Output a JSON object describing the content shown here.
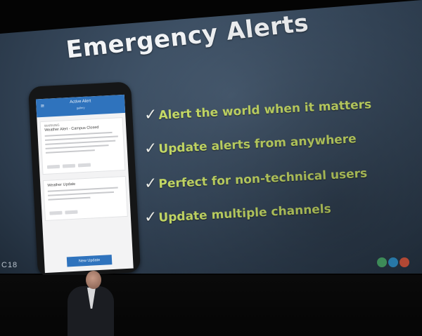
{
  "slide": {
    "title": "Emergency Alerts",
    "bullets": [
      "Alert the world when it matters",
      "Update alerts from anywhere",
      "Perfect for non-technical users",
      "Update multiple channels"
    ],
    "check_glyph": "✓",
    "code": "C18",
    "logo_colors": [
      "#4aa86a",
      "#2f8fc7",
      "#d2553e"
    ]
  },
  "phone": {
    "app_title": "Active Alert",
    "app_subtitle": "gallery",
    "menu_icon": "≡",
    "card1_label": "WARNING",
    "card1_title": "Weather Alert - Campus Closed",
    "card2_title": "Weather Update",
    "update_button": "New Update"
  },
  "colors": {
    "bullet_text": "#cfe56b",
    "title_text": "#f2f4f6",
    "app_bar": "#2f73bd"
  }
}
